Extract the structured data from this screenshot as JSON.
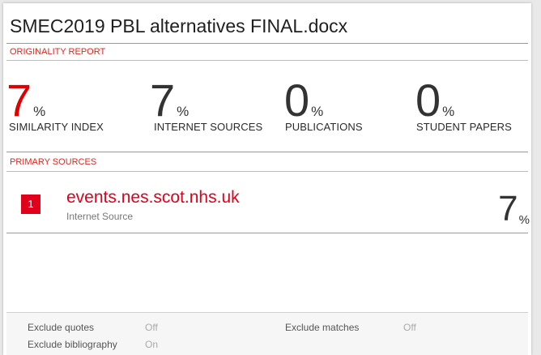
{
  "report": {
    "document_title": "SMEC2019 PBL alternatives FINAL.docx",
    "originality_label": "ORIGINALITY REPORT",
    "stats": [
      {
        "value": "7",
        "unit": "%",
        "label": "SIMILARITY INDEX",
        "highlight": true
      },
      {
        "value": "7",
        "unit": "%",
        "label": "INTERNET SOURCES",
        "highlight": false
      },
      {
        "value": "0",
        "unit": "%",
        "label": "PUBLICATIONS",
        "highlight": false
      },
      {
        "value": "0",
        "unit": "%",
        "label": "STUDENT PAPERS",
        "highlight": false
      }
    ],
    "primary_sources_label": "PRIMARY SOURCES",
    "sources": [
      {
        "rank": "1",
        "name": "events.nes.scot.nhs.uk",
        "type": "Internet Source",
        "percent": "7",
        "unit": "%"
      }
    ]
  },
  "footer": {
    "exclude_quotes": {
      "label": "Exclude quotes",
      "value": "Off"
    },
    "exclude_bibliography": {
      "label": "Exclude bibliography",
      "value": "On"
    },
    "exclude_matches": {
      "label": "Exclude matches",
      "value": "Off"
    }
  },
  "colors": {
    "accent_red": "#e0001b",
    "text_dark": "#333333",
    "page_background": "#ffffff"
  }
}
